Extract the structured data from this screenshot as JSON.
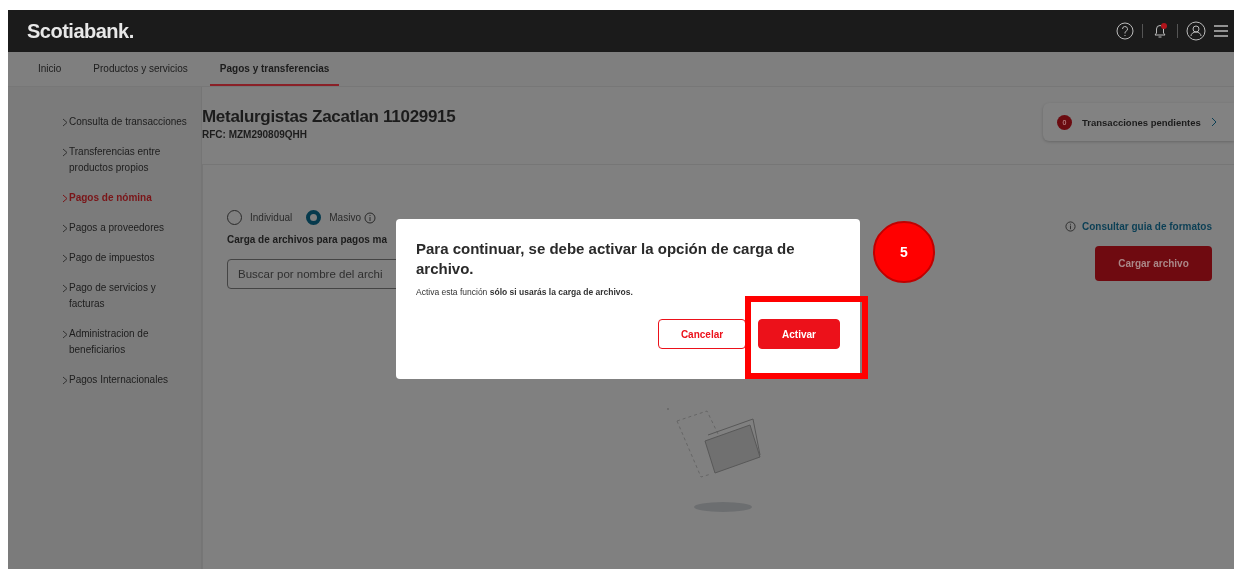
{
  "header": {
    "logo": "Scotiabank."
  },
  "nav": {
    "tabs": [
      {
        "label": "Inicio",
        "selected": false
      },
      {
        "label": "Productos y servicios",
        "selected": false
      },
      {
        "label": "Pagos y transferencias",
        "selected": true
      }
    ]
  },
  "sidebar": {
    "items": [
      {
        "label": "Consulta de transacciones",
        "selected": false
      },
      {
        "label": "Transferencias entre productos propios",
        "selected": false
      },
      {
        "label": "Pagos de nómina",
        "selected": true
      },
      {
        "label": "Pagos a proveedores",
        "selected": false
      },
      {
        "label": "Pago de impuestos",
        "selected": false
      },
      {
        "label": "Pago de servicios y facturas",
        "selected": false
      },
      {
        "label": "Administracion de beneficiarios",
        "selected": false
      },
      {
        "label": "Pagos Internacionales",
        "selected": false
      }
    ]
  },
  "account": {
    "title": "Metalurgistas Zacatlan 11029915",
    "rfc": "RFC: MZM290809QHH"
  },
  "pending": {
    "count": "0",
    "label": "Transacciones pendientes"
  },
  "modes": [
    {
      "label": "Individual",
      "selected": false
    },
    {
      "label": "Masivo",
      "selected": true
    }
  ],
  "format_link": "Consultar guia de formatos",
  "upload_label": "Carga de archivos para pagos ma",
  "search": {
    "placeholder": "Buscar por nombre del archi"
  },
  "upload_button": "Cargar archivo",
  "dialog": {
    "title": "Para continuar, se debe activar la opción de carga de archivo.",
    "message": "Activa esta función **sólo si usarás la carga de archivos.**",
    "buttons": [
      {
        "label": "Cancelar",
        "kind": "secondary"
      },
      {
        "label": "Activar",
        "kind": "primary"
      }
    ]
  },
  "annotation": {
    "step": "5"
  }
}
